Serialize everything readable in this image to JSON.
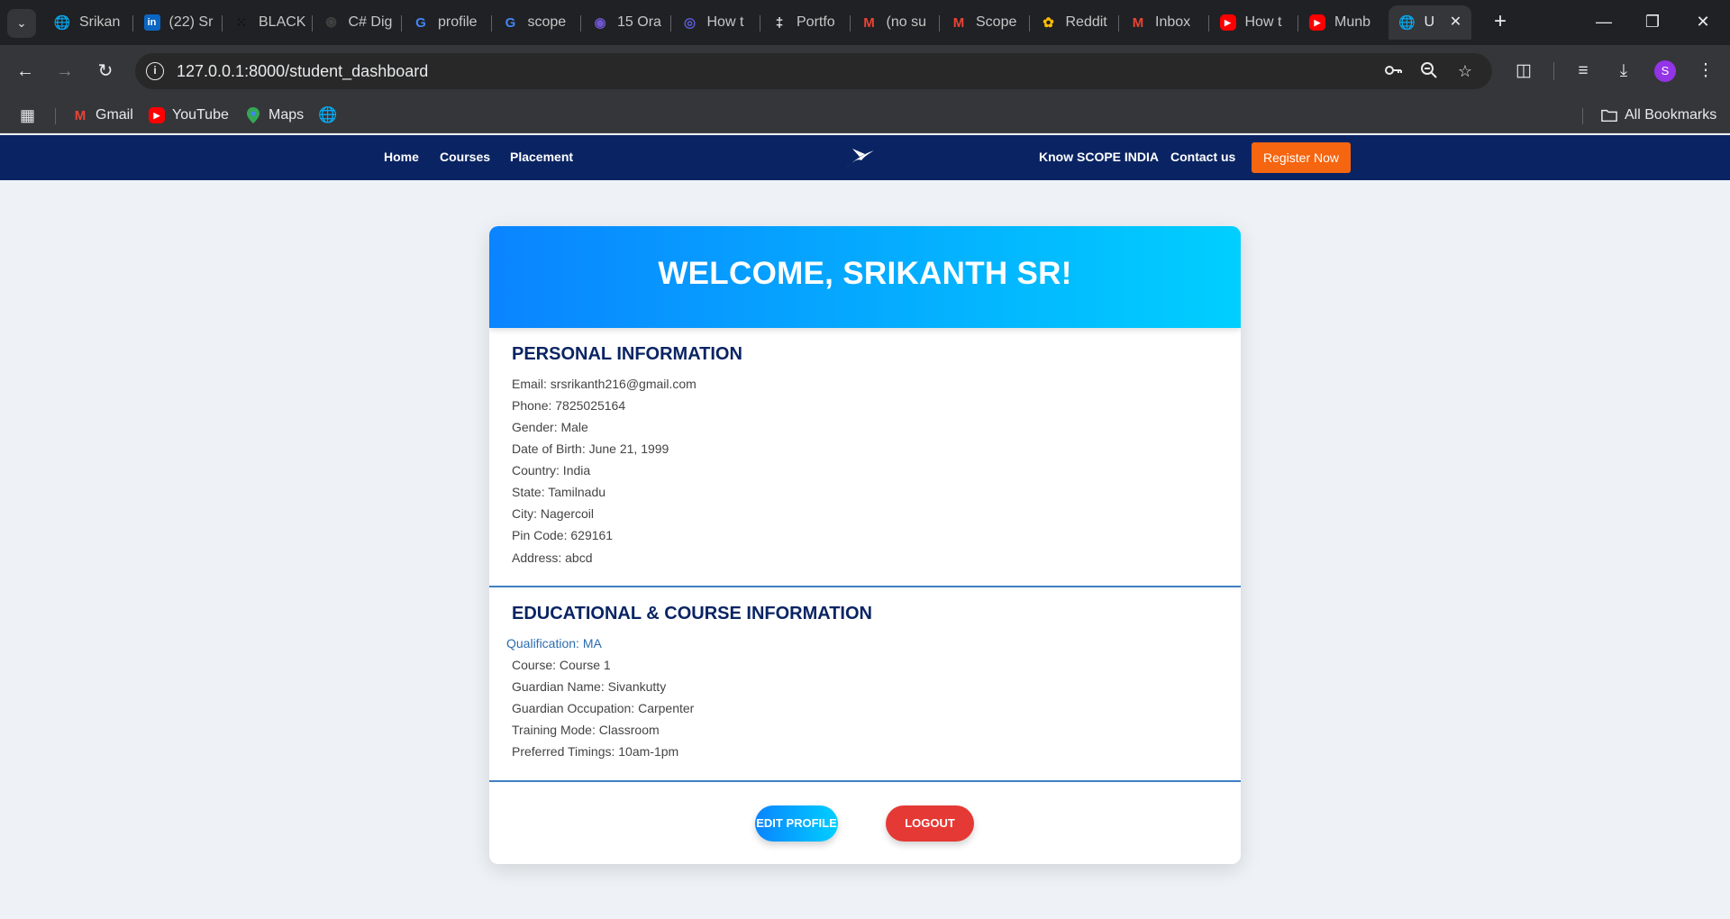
{
  "browser": {
    "tabs": [
      {
        "title": "Srikan",
        "icon": "globe-icon",
        "color": "#5f6368"
      },
      {
        "title": "(22) Sr",
        "icon": "linkedin-icon",
        "color": "#0a66c2"
      },
      {
        "title": "BLACK",
        "icon": "dots-icon",
        "color": "#111111"
      },
      {
        "title": "C# Dig",
        "icon": "openai-icon",
        "color": "#444444"
      },
      {
        "title": "profile",
        "icon": "google-icon",
        "color": "#4285f4"
      },
      {
        "title": "scope",
        "icon": "google-icon",
        "color": "#4285f4"
      },
      {
        "title": "15 Ora",
        "icon": "gemini-icon",
        "color": "#6e56cf"
      },
      {
        "title": "How t",
        "icon": "circle-app-icon",
        "color": "#5b5bd6"
      },
      {
        "title": "Portfo",
        "icon": "pin-icon",
        "color": "#e8eaed"
      },
      {
        "title": "(no su",
        "icon": "gmail-icon",
        "color": "#ea4335"
      },
      {
        "title": "Scope",
        "icon": "gmail-icon",
        "color": "#ea4335"
      },
      {
        "title": "Reddit",
        "icon": "photos-icon",
        "color": "#fbbc04"
      },
      {
        "title": "Inbox",
        "icon": "gmail-icon",
        "color": "#ea4335"
      },
      {
        "title": "How t",
        "icon": "youtube-icon",
        "color": "#ff0000"
      },
      {
        "title": "Munb",
        "icon": "youtube-icon",
        "color": "#ff0000"
      }
    ],
    "active_tab": {
      "title": "U",
      "icon": "globe-icon"
    },
    "url": "127.0.0.1:8000/student_dashboard",
    "profile_initial": "S",
    "bookmarks": [
      {
        "label": "Gmail",
        "icon": "gmail-icon"
      },
      {
        "label": "YouTube",
        "icon": "youtube-icon"
      },
      {
        "label": "Maps",
        "icon": "maps-icon"
      }
    ],
    "all_bookmarks": "All Bookmarks"
  },
  "site_nav": {
    "left_links": [
      "Home",
      "Courses",
      "Placement"
    ],
    "right_links": [
      "Know SCOPE INDIA",
      "Contact us"
    ],
    "register": "Register Now",
    "brand_color": "#0a2463",
    "accent_color": "#f6650f"
  },
  "dashboard": {
    "welcome": "WELCOME, SRIKANTH SR!",
    "personal": {
      "title": "PERSONAL INFORMATION",
      "rows": [
        "Email: srsrikanth216@gmail.com",
        "Phone: 7825025164",
        "Gender: Male",
        "Date of Birth: June 21, 1999",
        "Country: India",
        "State: Tamilnadu",
        "City: Nagercoil",
        "Pin Code: 629161",
        "Address: abcd"
      ]
    },
    "education": {
      "title": "EDUCATIONAL & COURSE INFORMATION",
      "rows": [
        "Qualification: MA",
        "Course: Course 1",
        "Guardian Name: Sivankutty",
        "Guardian Occupation: Carpenter",
        "Training Mode: Classroom",
        "Preferred Timings: 10am-1pm"
      ]
    },
    "edit_button": "EDIT PROFILE",
    "logout_button": "LOGOUT"
  }
}
